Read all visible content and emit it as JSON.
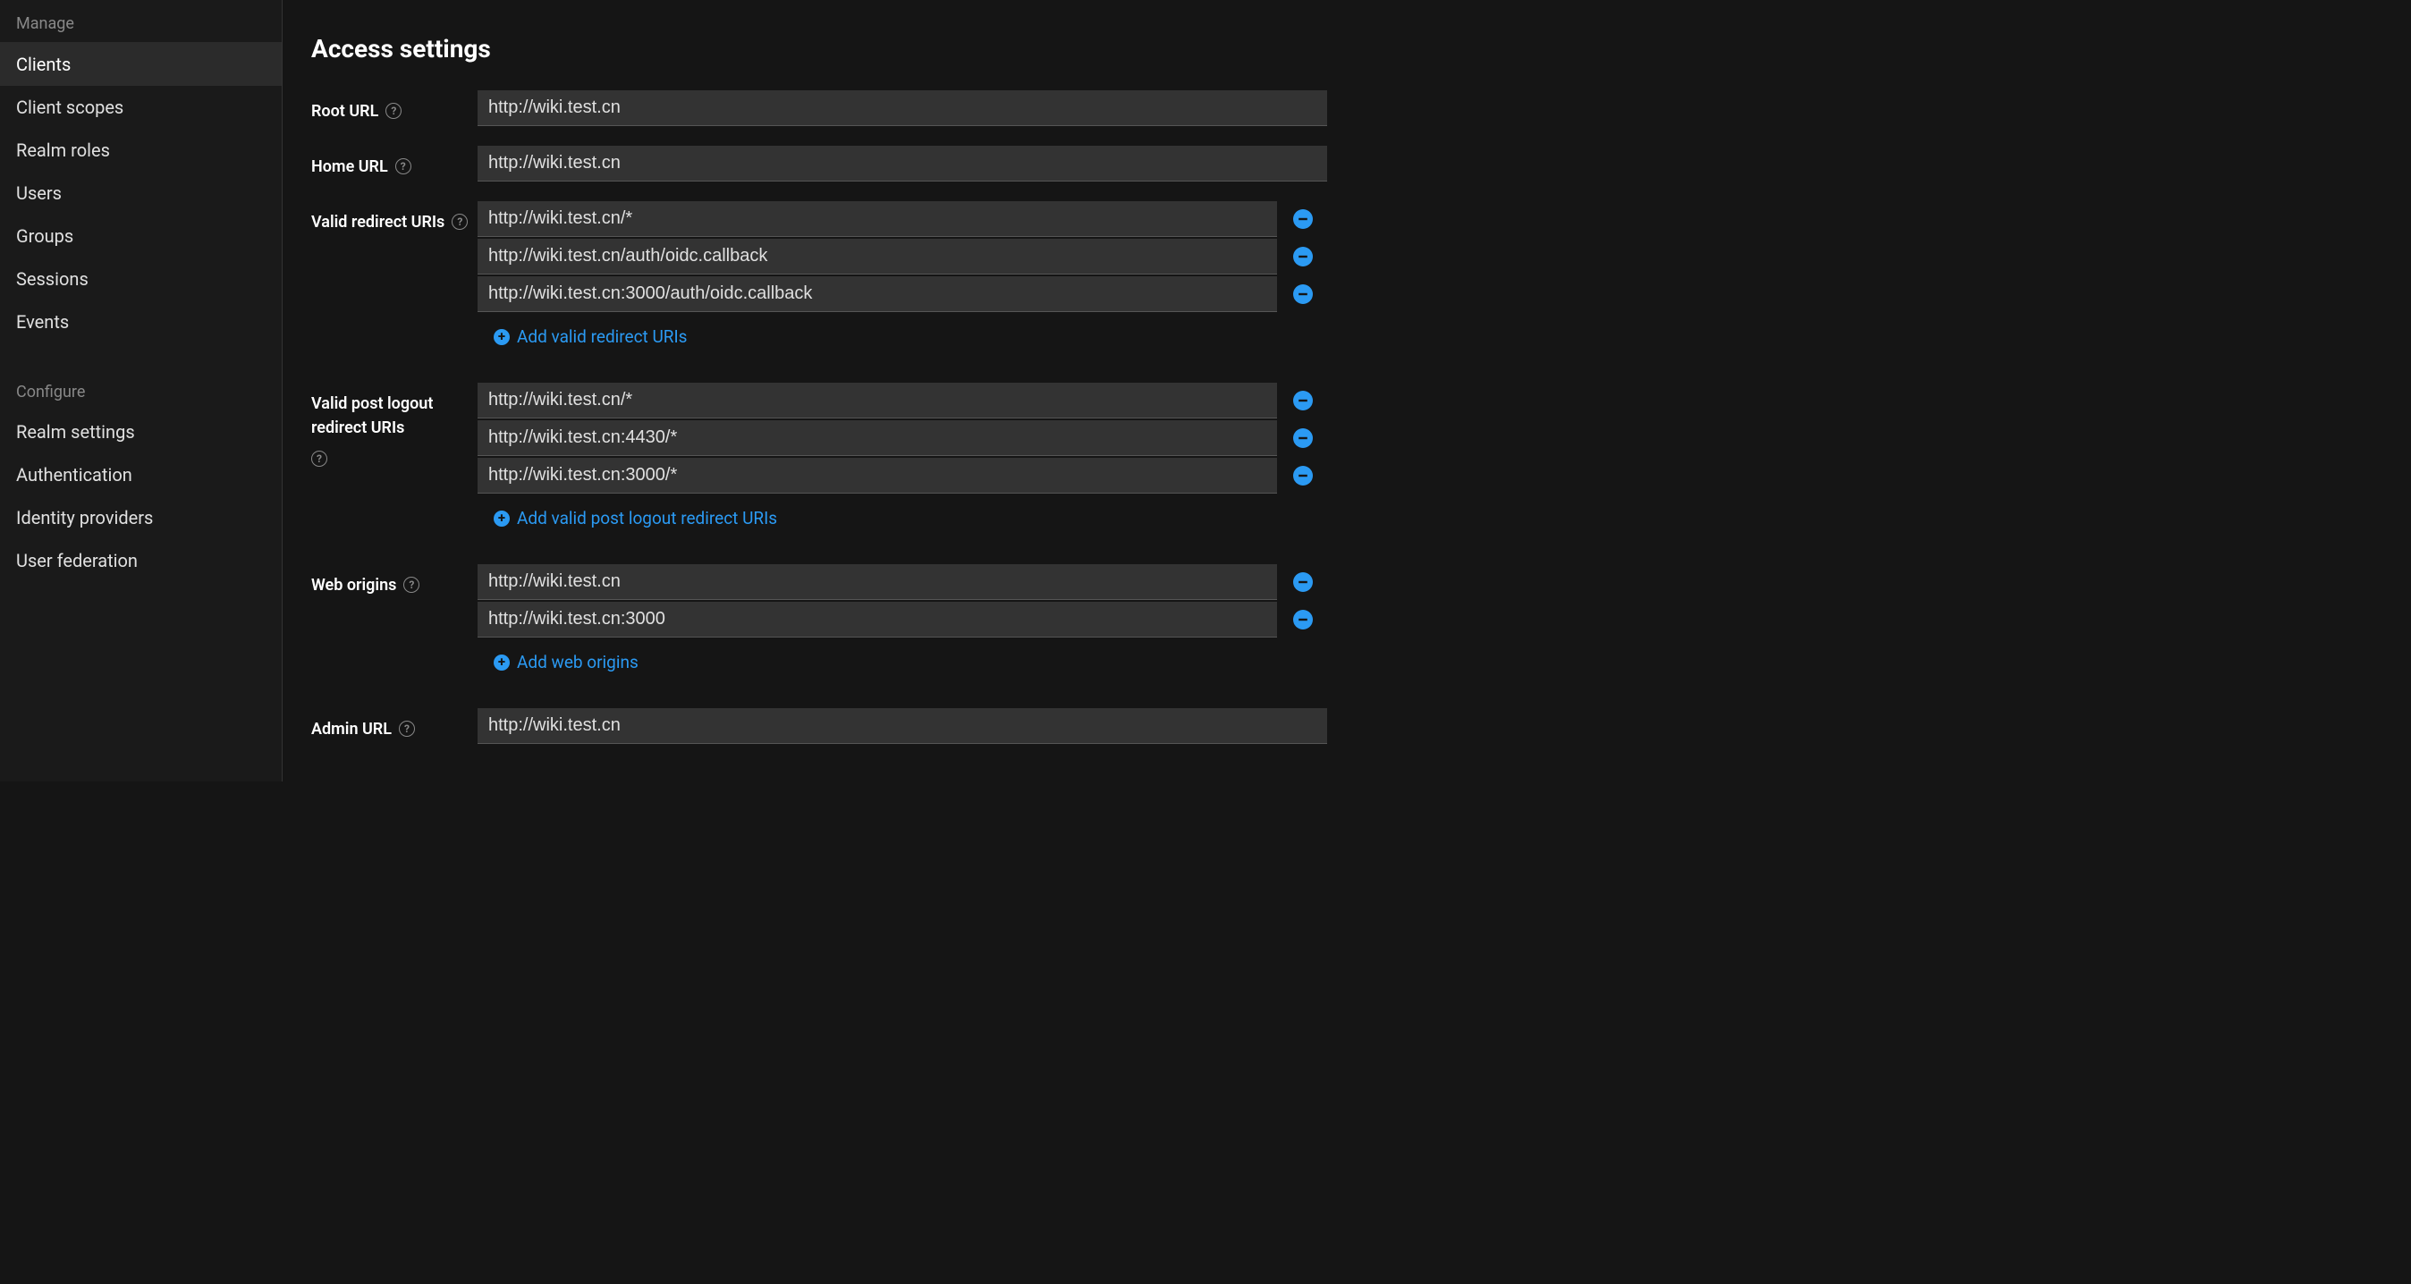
{
  "sidebar": {
    "manage_title": "Manage",
    "manage_items": [
      {
        "label": "Clients",
        "active": true
      },
      {
        "label": "Client scopes",
        "active": false
      },
      {
        "label": "Realm roles",
        "active": false
      },
      {
        "label": "Users",
        "active": false
      },
      {
        "label": "Groups",
        "active": false
      },
      {
        "label": "Sessions",
        "active": false
      },
      {
        "label": "Events",
        "active": false
      }
    ],
    "configure_title": "Configure",
    "configure_items": [
      {
        "label": "Realm settings"
      },
      {
        "label": "Authentication"
      },
      {
        "label": "Identity providers"
      },
      {
        "label": "User federation"
      }
    ]
  },
  "main": {
    "section_title": "Access settings",
    "root_url": {
      "label": "Root URL",
      "value": "http://wiki.test.cn"
    },
    "home_url": {
      "label": "Home URL",
      "value": "http://wiki.test.cn"
    },
    "valid_redirect": {
      "label": "Valid redirect URIs",
      "values": [
        "http://wiki.test.cn/*",
        "http://wiki.test.cn/auth/oidc.callback",
        "http://wiki.test.cn:3000/auth/oidc.callback"
      ],
      "add_label": "Add valid redirect URIs"
    },
    "valid_post_logout": {
      "label": "Valid post logout redirect URIs",
      "values": [
        "http://wiki.test.cn/*",
        "http://wiki.test.cn:4430/*",
        "http://wiki.test.cn:3000/*"
      ],
      "add_label": "Add valid post logout redirect URIs"
    },
    "web_origins": {
      "label": "Web origins",
      "values": [
        "http://wiki.test.cn",
        "http://wiki.test.cn:3000"
      ],
      "add_label": "Add web origins"
    },
    "admin_url": {
      "label": "Admin URL",
      "value": "http://wiki.test.cn"
    }
  },
  "icons": {
    "help": "?",
    "plus": "+"
  },
  "colors": {
    "accent": "#2b9af3",
    "bg": "#151515",
    "sidebar_bg": "#1a1a1a",
    "input_bg": "#333"
  }
}
